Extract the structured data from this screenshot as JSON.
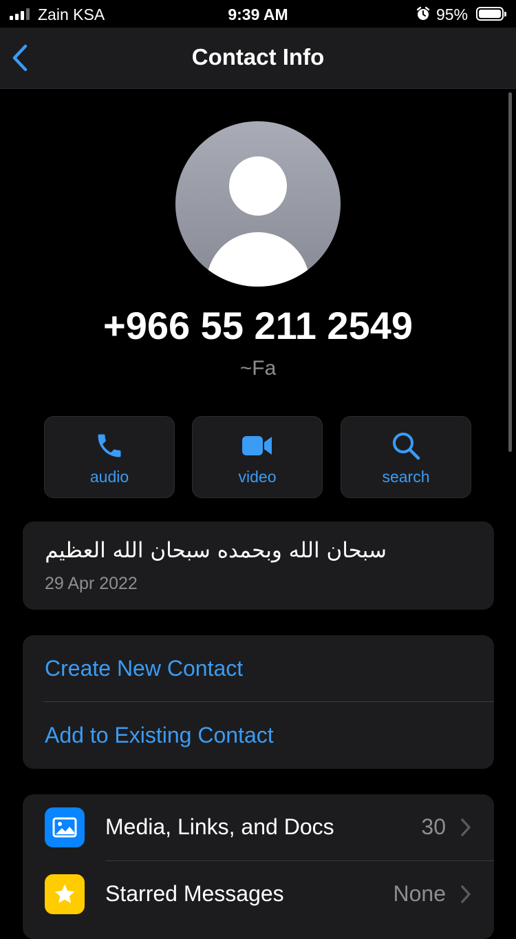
{
  "status_bar": {
    "carrier": "Zain KSA",
    "time": "9:39 AM",
    "battery_percent": "95%"
  },
  "nav": {
    "title": "Contact Info"
  },
  "profile": {
    "phone_number": "+966 55 211 2549",
    "push_name": "~Fa"
  },
  "actions": [
    {
      "label": "audio",
      "icon": "phone-icon"
    },
    {
      "label": "video",
      "icon": "video-camera-icon"
    },
    {
      "label": "search",
      "icon": "magnifier-icon"
    }
  ],
  "about": {
    "text": "سبحان الله وبحمده سبحان الله العظيم",
    "date": "29 Apr 2022"
  },
  "contact_options": {
    "create_new": "Create New Contact",
    "add_existing": "Add to Existing Contact"
  },
  "list_rows": [
    {
      "label": "Media, Links, and Docs",
      "value": "30",
      "icon": "photo-icon",
      "icon_color": "#0a84ff"
    },
    {
      "label": "Starred Messages",
      "value": "None",
      "icon": "star-icon",
      "icon_color": "#ffcc00"
    }
  ],
  "colors": {
    "accent": "#3a9cf5",
    "background": "#000000",
    "card": "#1c1c1e",
    "secondary_text": "#8d8d93"
  }
}
